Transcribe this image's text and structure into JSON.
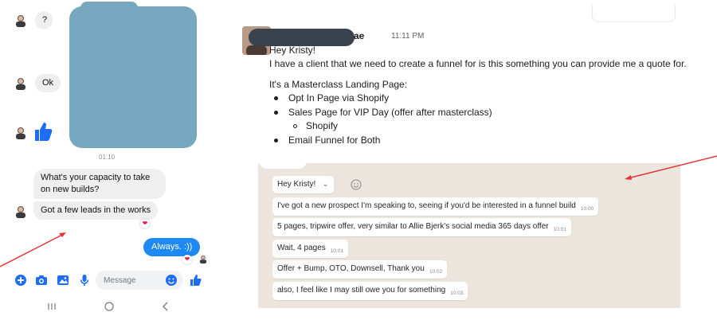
{
  "messenger": {
    "messages": [
      {
        "text": "?"
      },
      {
        "text": "Ok"
      },
      {
        "text": "What's your capacity to take on new builds?"
      },
      {
        "text": "Got a few leads in the works"
      }
    ],
    "timestamp": "01:10",
    "outgoing": {
      "text": "Always. :))"
    },
    "reaction": "❤",
    "composer": {
      "placeholder": "Message"
    },
    "icons": [
      "plus-icon",
      "camera-icon",
      "image-icon",
      "microphone-icon",
      "emoji-icon",
      "like-icon"
    ]
  },
  "slack": {
    "sender_tail": "ae",
    "time": "11:11 PM",
    "lines": [
      "Hey Kristy!",
      "I have a client that we need to create a funnel for is this something you can provide me a quote for.",
      "It's a Masterclass Landing Page:"
    ],
    "bullets": [
      "Opt In Page via Shopify",
      "Sales Page for VIP Day (offer after masterclass)"
    ],
    "sub_bullets": [
      "Shopify"
    ],
    "bullets_after": [
      "Email Funnel for Both"
    ]
  },
  "whatsapp": {
    "messages": [
      {
        "text": "Hey Kristy!",
        "time": ""
      },
      {
        "text": "I've got a new prospect I'm speaking to, seeing if you'd be interested in a funnel build",
        "time": "10:00"
      },
      {
        "text": "5 pages, tripwire offer, very similar to Allie Bjerk's social media 365 days offer",
        "time": "10:01"
      },
      {
        "text": "Wait, 4 pages",
        "time": "10:01"
      },
      {
        "text": "Offer + Bump, OTO, Downsell, Thank you",
        "time": "10:02"
      },
      {
        "text": "also, I feel like I may still owe you for something",
        "time": "10:03"
      }
    ]
  },
  "colors": {
    "messenger_blue": "#1e88f3",
    "annotation_red": "#e0363a",
    "whatsapp_bg": "#ece5dd"
  }
}
